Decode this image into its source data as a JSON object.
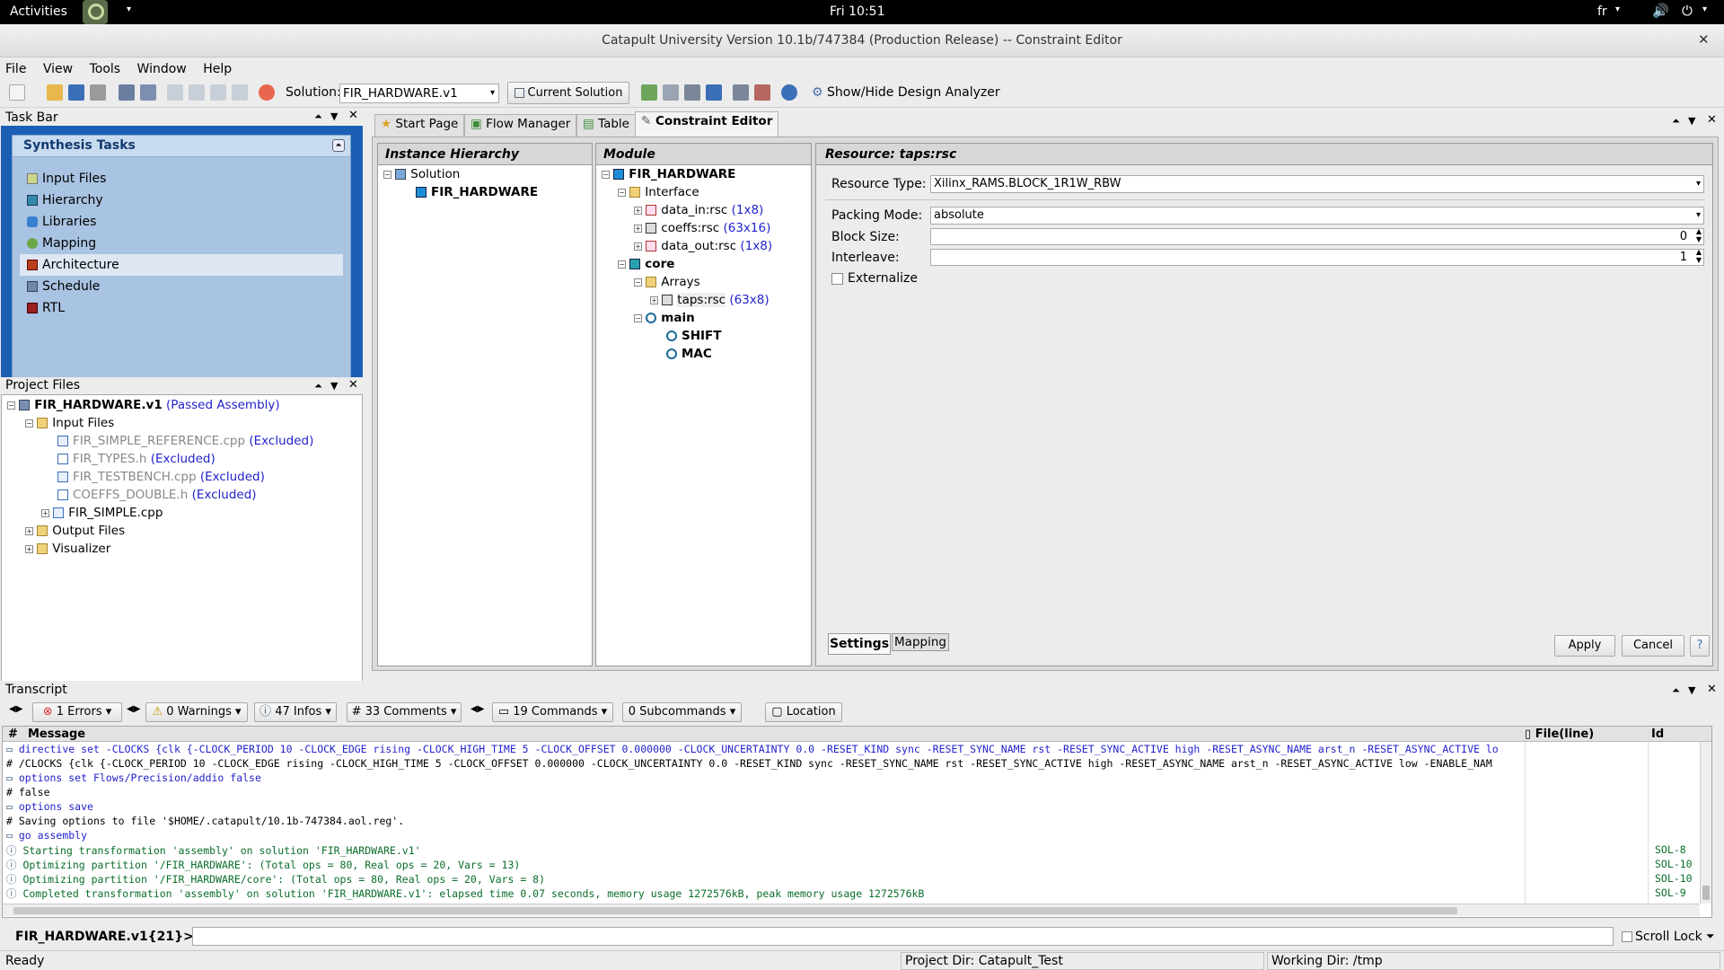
{
  "topbar": {
    "activities": "Activities",
    "clock": "Fri 10:51",
    "lang": "fr"
  },
  "window": {
    "title": "Catapult University Version 10.1b/747384 (Production Release) -- Constraint Editor"
  },
  "menu": [
    "File",
    "View",
    "Tools",
    "Window",
    "Help"
  ],
  "toolbar": {
    "solution_label": "Solution:",
    "solution_value": "FIR_HARDWARE.v1",
    "current_solution": "Current Solution",
    "design_analyzer": "Show/Hide Design Analyzer"
  },
  "taskbar": {
    "title": "Task Bar",
    "section": "Synthesis Tasks",
    "items": [
      "Input Files",
      "Hierarchy",
      "Libraries",
      "Mapping",
      "Architecture",
      "Schedule",
      "RTL"
    ]
  },
  "project_files": {
    "title": "Project Files",
    "root": "FIR_HARDWARE.v1",
    "root_status": "(Passed Assembly)",
    "input_files": "Input Files",
    "files": [
      {
        "name": "FIR_SIMPLE_REFERENCE.cpp",
        "status": "(Excluded)"
      },
      {
        "name": "FIR_TYPES.h",
        "status": "(Excluded)"
      },
      {
        "name": "FIR_TESTBENCH.cpp",
        "status": "(Excluded)"
      },
      {
        "name": "COEFFS_DOUBLE.h",
        "status": "(Excluded)"
      },
      {
        "name": "FIR_SIMPLE.cpp",
        "status": ""
      }
    ],
    "output_files": "Output Files",
    "visualizer": "Visualizer"
  },
  "tabs": [
    "Start Page",
    "Flow Manager",
    "Table",
    "Constraint Editor"
  ],
  "instance_hierarchy": {
    "title": "Instance Hierarchy",
    "solution": "Solution",
    "fir": "FIR_HARDWARE"
  },
  "module": {
    "title": "Module",
    "root": "FIR_HARDWARE",
    "interface": "Interface",
    "data_in": "data_in:rsc",
    "data_in_dim": "(1x8)",
    "coeffs": "coeffs:rsc",
    "coeffs_dim": "(63x16)",
    "data_out": "data_out:rsc",
    "data_out_dim": "(1x8)",
    "core": "core",
    "arrays": "Arrays",
    "taps": "taps:rsc",
    "taps_dim": "(63x8)",
    "main": "main",
    "shift": "SHIFT",
    "mac": "MAC"
  },
  "resource": {
    "title": "Resource: taps:rsc",
    "type_label": "Resource Type:",
    "type_value": "Xilinx_RAMS.BLOCK_1R1W_RBW",
    "packing_label": "Packing Mode:",
    "packing_value": "absolute",
    "block_label": "Block Size:",
    "block_value": "0",
    "interleave_label": "Interleave:",
    "interleave_value": "1",
    "externalize": "Externalize",
    "settings_tab": "Settings",
    "mapping_tab": "Mapping",
    "apply": "Apply",
    "cancel": "Cancel"
  },
  "transcript": {
    "title": "Transcript",
    "errors": "1 Errors",
    "warnings": "0 Warnings",
    "infos": "47 Infos",
    "comments": "33 Comments",
    "commands": "19 Commands",
    "subcommands": "0 Subcommands",
    "location": "Location",
    "col_hash": "#",
    "col_message": "Message",
    "col_file": "File(line)",
    "col_id": "Id",
    "lines": [
      {
        "kind": "cmd",
        "text": "directive set -CLOCKS {clk {-CLOCK_PERIOD 10 -CLOCK_EDGE rising -CLOCK_HIGH_TIME 5 -CLOCK_OFFSET 0.000000 -CLOCK_UNCERTAINTY 0.0 -RESET_KIND sync -RESET_SYNC_NAME rst -RESET_SYNC_ACTIVE high -RESET_ASYNC_NAME arst_n -RESET_ASYNC_ACTIVE lo",
        "id": ""
      },
      {
        "kind": "comment",
        "text": " /CLOCKS {clk {-CLOCK_PERIOD 10 -CLOCK_EDGE rising -CLOCK_HIGH_TIME 5 -CLOCK_OFFSET 0.000000 -CLOCK_UNCERTAINTY 0.0 -RESET_KIND sync -RESET_SYNC_NAME rst -RESET_SYNC_ACTIVE high -RESET_ASYNC_NAME arst_n -RESET_ASYNC_ACTIVE low -ENABLE_NAM",
        "id": ""
      },
      {
        "kind": "cmd",
        "text": "options set Flows/Precision/addio false",
        "id": ""
      },
      {
        "kind": "comment",
        "text": " false",
        "id": ""
      },
      {
        "kind": "cmd",
        "text": "options save",
        "id": ""
      },
      {
        "kind": "comment",
        "text": " Saving options to file '$HOME/.catapult/10.1b-747384.aol.reg'.",
        "id": ""
      },
      {
        "kind": "cmd",
        "text": "go assembly",
        "id": ""
      },
      {
        "kind": "info",
        "text": " Starting transformation 'assembly' on solution 'FIR_HARDWARE.v1'",
        "id": "SOL-8"
      },
      {
        "kind": "info",
        "text": " Optimizing partition '/FIR_HARDWARE': (Total ops = 80, Real ops = 20, Vars = 13)",
        "id": "SOL-10"
      },
      {
        "kind": "info",
        "text": " Optimizing partition '/FIR_HARDWARE/core': (Total ops = 80, Real ops = 20, Vars = 8)",
        "id": "SOL-10"
      },
      {
        "kind": "info",
        "text": " Completed transformation 'assembly' on solution 'FIR_HARDWARE.v1': elapsed time 0.07 seconds, memory usage 1272576kB, peak memory usage 1272576kB",
        "id": "SOL-9"
      }
    ],
    "prompt": "FIR_HARDWARE.v1{21}>",
    "scroll_lock": "Scroll Lock"
  },
  "status": {
    "ready": "Ready",
    "project_dir": "Project Dir: Catapult_Test",
    "working_dir": "Working Dir: /tmp"
  }
}
